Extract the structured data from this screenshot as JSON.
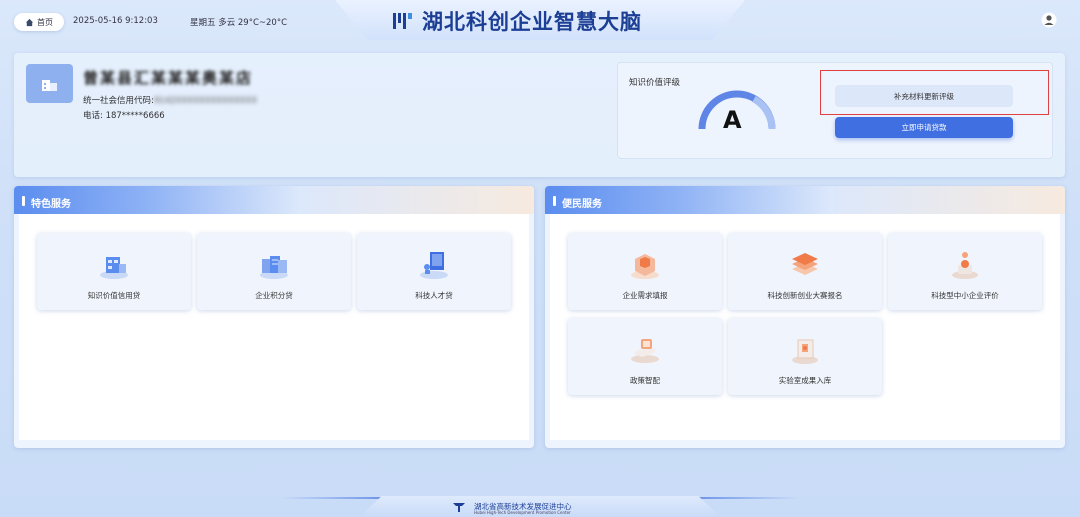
{
  "header": {
    "home_label": "首页",
    "datetime": "2025-05-16  9:12:03",
    "weather": "星期五  多云  29°C~20°C",
    "title": "湖北科创企业智慧大脑"
  },
  "company": {
    "name": "曾某县汇某某某奥某店",
    "credit_code_label": "统一社会信用代码:",
    "credit_code_value": "9142XXXXXXXXXXXXXX",
    "phone": "电话: 187*****6666"
  },
  "evaluation": {
    "label": "知识价值评级",
    "grade": "A",
    "supplement_button": "补充材料更新评级",
    "apply_button": "立即申请贷款"
  },
  "featured_services": {
    "title": "特色服务",
    "items": [
      {
        "label": "知识价值信用贷",
        "icon": "building-credit-icon"
      },
      {
        "label": "企业积分贷",
        "icon": "server-stack-icon"
      },
      {
        "label": "科技人才贷",
        "icon": "monitor-tech-icon"
      }
    ]
  },
  "public_services": {
    "title": "便民服务",
    "items": [
      {
        "label": "企业需求填报",
        "icon": "cube-form-icon"
      },
      {
        "label": "科技创新创业大赛报名",
        "icon": "layers-stack-icon"
      },
      {
        "label": "科技型中小企业评价",
        "icon": "evaluation-tower-icon"
      },
      {
        "label": "政策智配",
        "icon": "policy-hand-icon"
      },
      {
        "label": "实验室成果入库",
        "icon": "lab-results-icon"
      }
    ]
  },
  "footer": {
    "org_cn": "湖北省高新技术发展促进中心",
    "org_en": "Hubei High-Tech Development Promotion Center"
  },
  "colors": {
    "brand": "#1c3f95",
    "accent": "#3f6fe0",
    "highlight_box": "#e04040"
  }
}
